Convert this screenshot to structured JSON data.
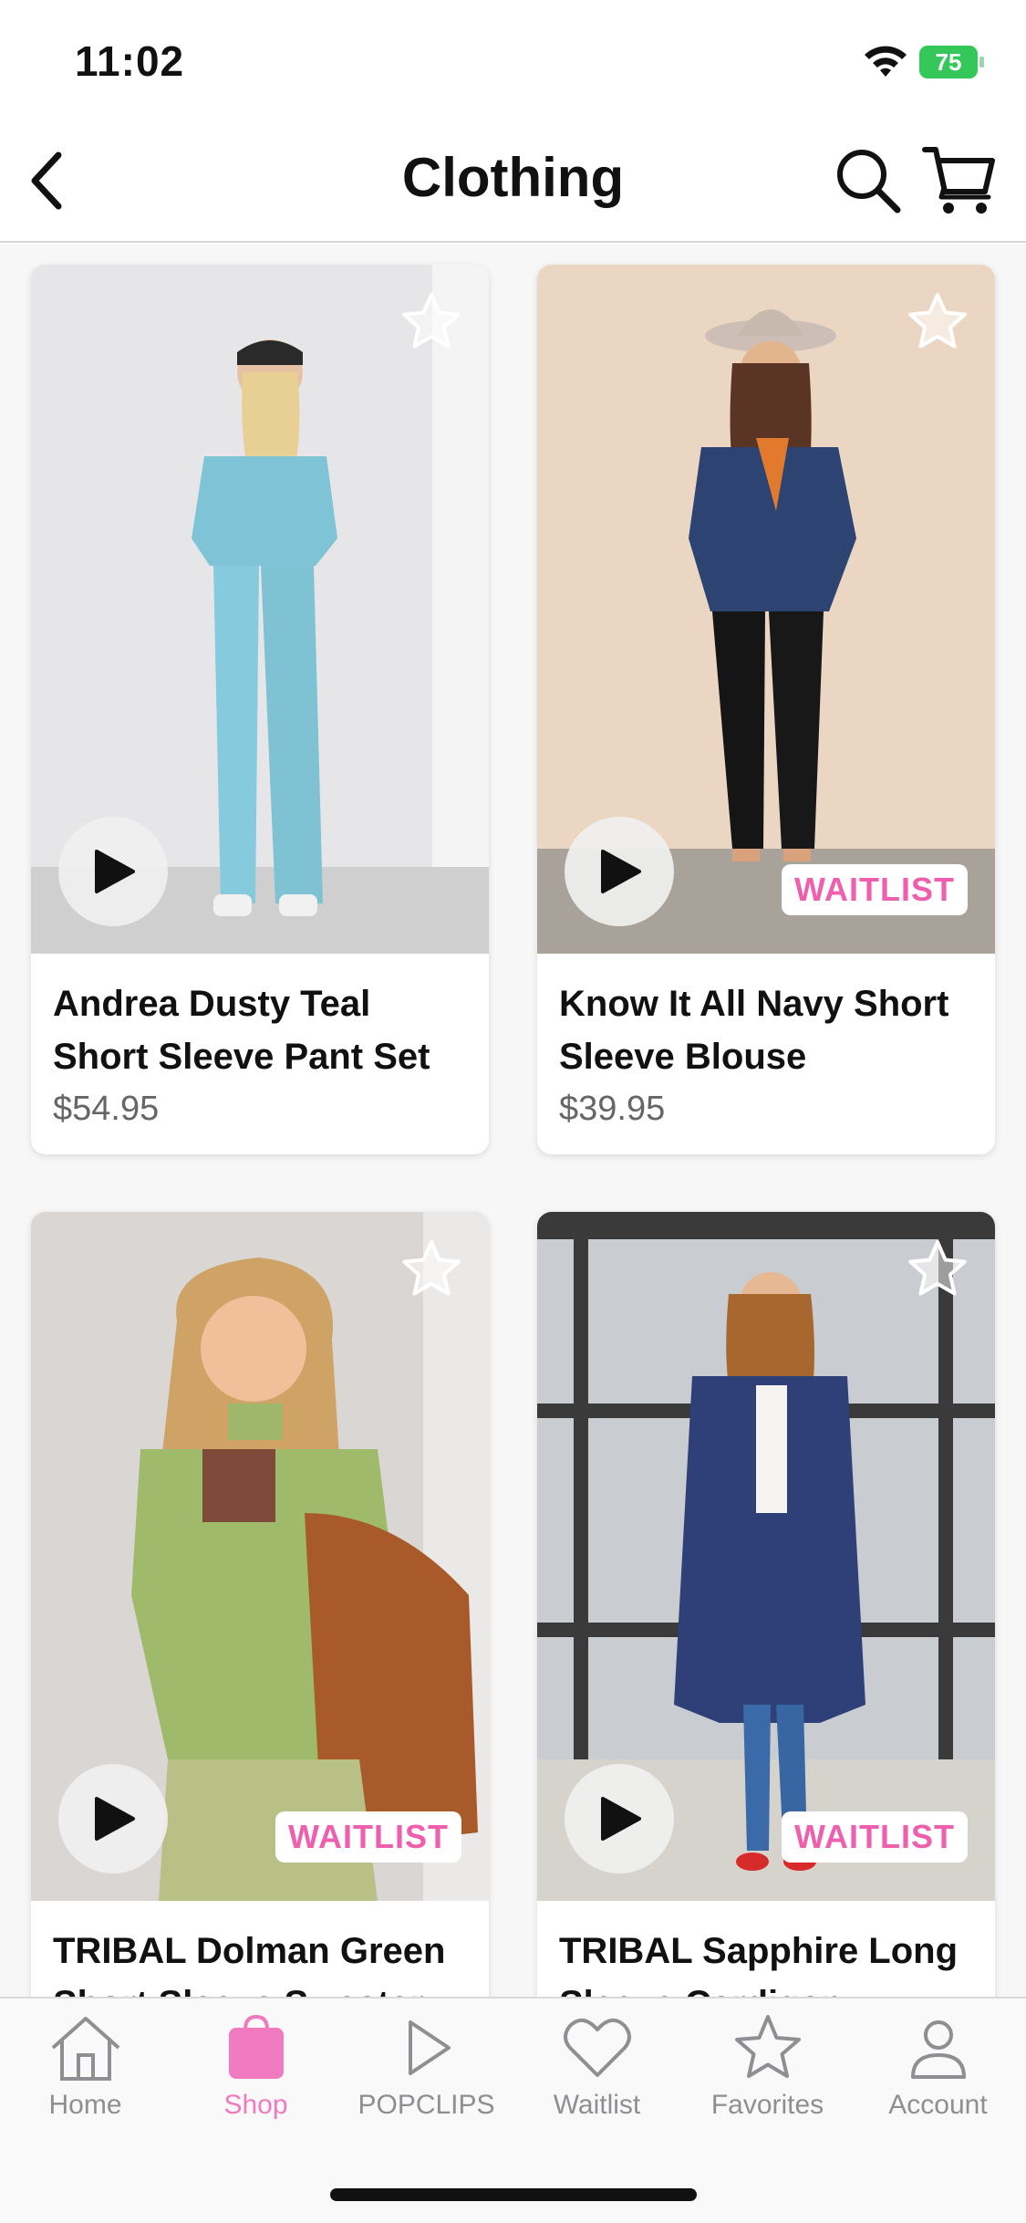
{
  "status_bar": {
    "time": "11:02",
    "battery": "75"
  },
  "nav": {
    "title": "Clothing",
    "back_icon": "chevron-left-icon",
    "search_icon": "search-icon",
    "cart_icon": "cart-icon"
  },
  "products": [
    {
      "title": "Andrea Dusty Teal Short Sleeve Pant Set",
      "price": "$54.95",
      "waitlist": ""
    },
    {
      "title": "Know It All Navy Short Sleeve Blouse",
      "price": "$39.95",
      "waitlist": "WAITLIST"
    },
    {
      "title": "TRIBAL Dolman Green Short Sleeve Sweater",
      "price": "",
      "waitlist": "WAITLIST"
    },
    {
      "title": "TRIBAL Sapphire Long Sleeve Cardigan",
      "price": "",
      "waitlist": "WAITLIST"
    }
  ],
  "tabs": [
    {
      "label": "Home",
      "icon": "home-icon"
    },
    {
      "label": "Shop",
      "icon": "shopping-bag-icon",
      "active": true
    },
    {
      "label": "POPCLIPS",
      "icon": "play-icon"
    },
    {
      "label": "Waitlist",
      "icon": "heart-icon"
    },
    {
      "label": "Favorites",
      "icon": "star-icon"
    },
    {
      "label": "Account",
      "icon": "person-icon"
    }
  ],
  "colors": {
    "accent_pink": "#ee5fae",
    "tab_inactive": "#8e8e93",
    "battery_green": "#35c759"
  }
}
